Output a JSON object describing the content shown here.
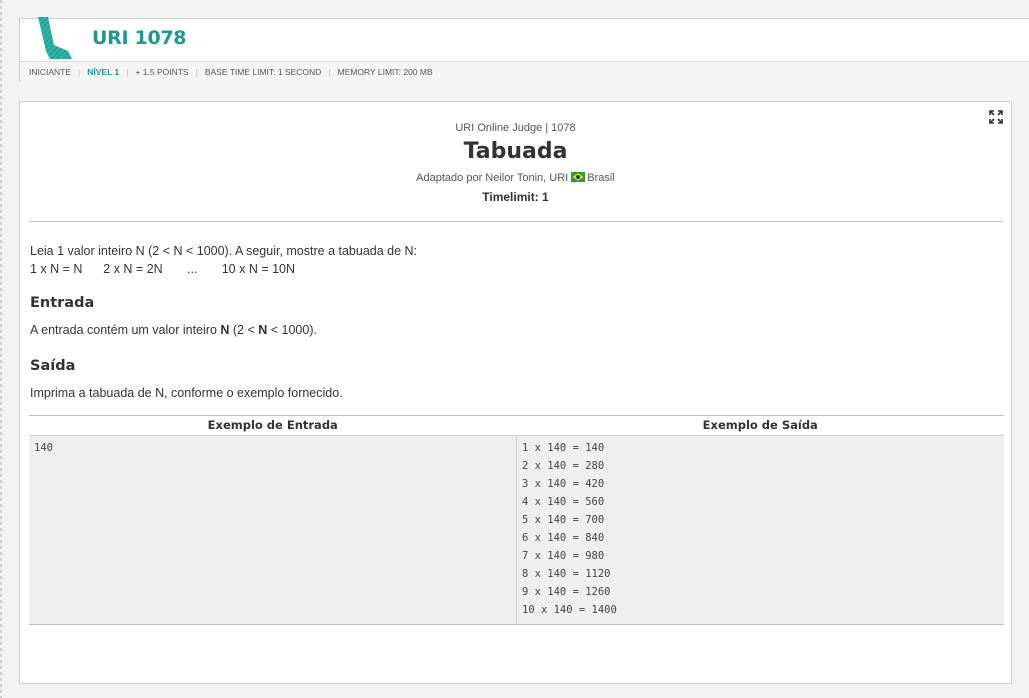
{
  "header": {
    "problem_name": "URI 1078",
    "meta": {
      "category": "INICIANTE",
      "level": "NÍVEL 1",
      "points": "+ 1.5 POINTS",
      "base_time_limit": "BASE TIME LIMIT: 1 SECOND",
      "memory_limit": "MEMORY LIMIT: 200 MB"
    },
    "accent_color": "#1f9990"
  },
  "problem": {
    "judge_line": "URI Online Judge | 1078",
    "title": "Tabuada",
    "author_prefix": "Adaptado por Neilor Tonin, URI",
    "country": "Brasil",
    "timelimit": "Timelimit: 1",
    "description_line1": "Leia 1 valor inteiro N (2 < N < 1000). A seguir, mostre a tabuada de N:",
    "description_line2": "1 x N = N      2 x N = 2N       ...       10 x N = 10N",
    "input_title": "Entrada",
    "input_text_pre": "A entrada contém um valor inteiro ",
    "input_text_bold1": "N",
    "input_text_mid": " (2 < ",
    "input_text_bold2": "N",
    "input_text_post": " < 1000).",
    "output_title": "Saída",
    "output_text": "Imprima a tabuada de N, conforme o exemplo fornecido."
  },
  "examples": {
    "input_header": "Exemplo de Entrada",
    "output_header": "Exemplo de Saída",
    "input": "140",
    "output_lines": [
      "1 x 140 = 140",
      "2 x 140 = 280",
      "3 x 140 = 420",
      "4 x 140 = 560",
      "5 x 140 = 700",
      "6 x 140 = 840",
      "7 x 140 = 980",
      "8 x 140 = 1120",
      "9 x 140 = 1260",
      "10 x 140 = 1400"
    ]
  },
  "icons": {
    "expand": "expand-icon",
    "flag": "brazil-flag-icon",
    "logo": "level-1-logo"
  }
}
